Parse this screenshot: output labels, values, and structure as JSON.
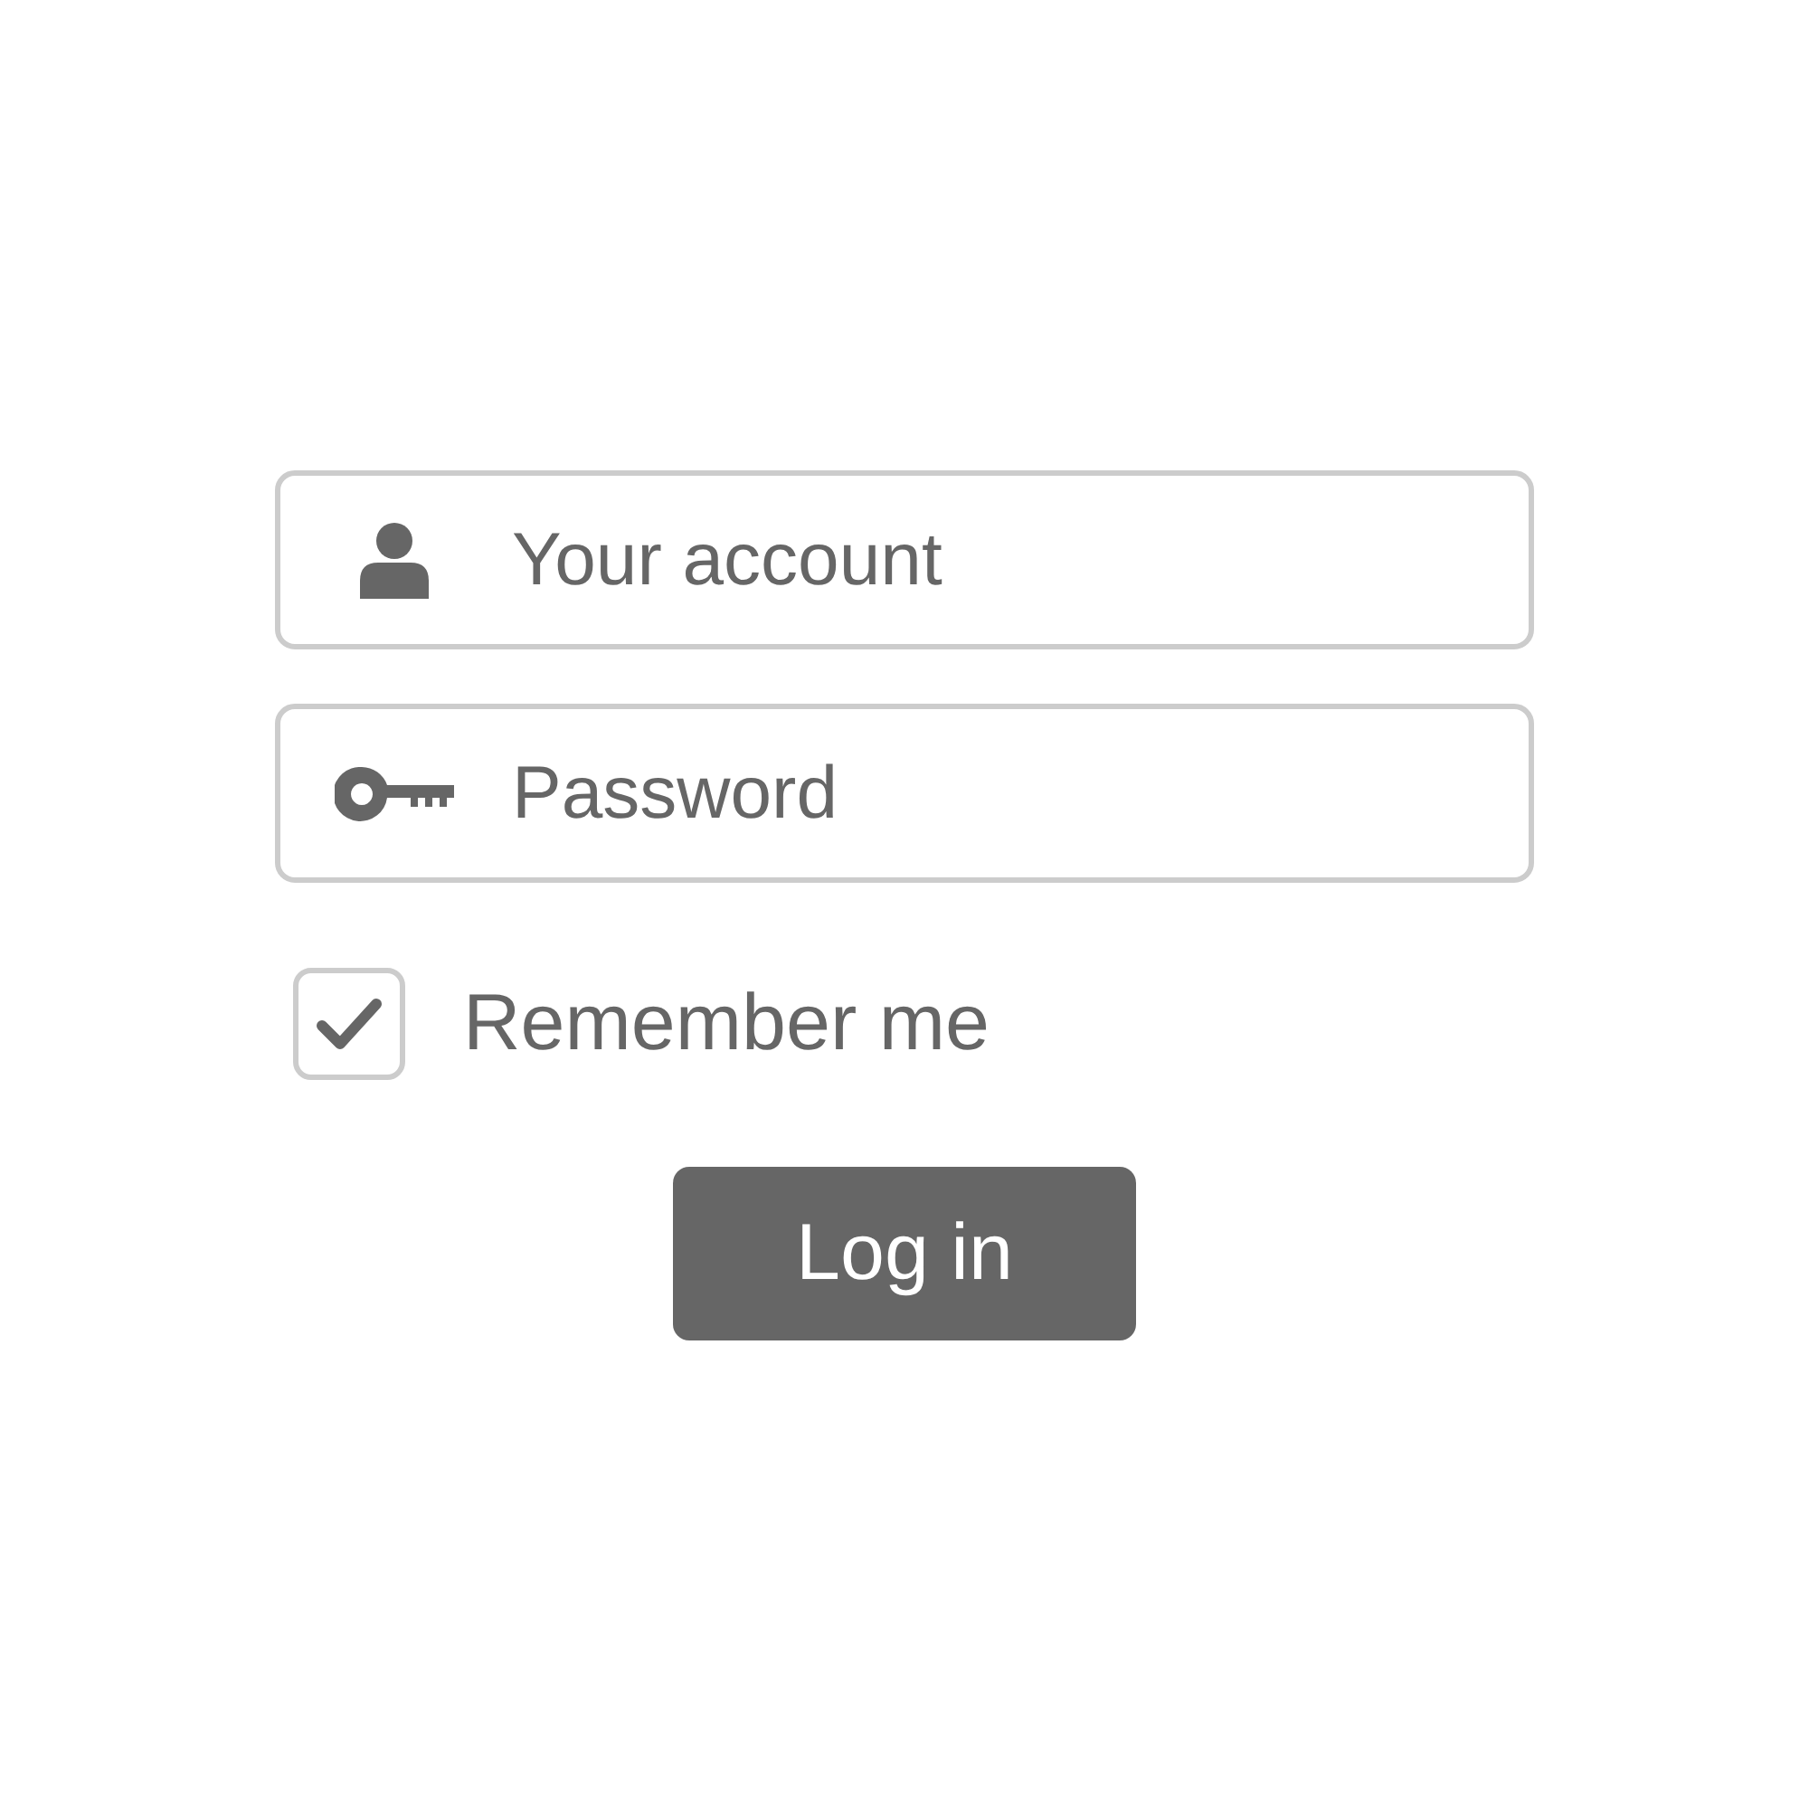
{
  "fields": [
    {
      "kind": "account",
      "placeholder": "Your account"
    },
    {
      "kind": "password",
      "placeholder": "Password"
    }
  ],
  "remember": {
    "label": "Remember me",
    "checked": true
  },
  "button": {
    "label": "Log in"
  }
}
